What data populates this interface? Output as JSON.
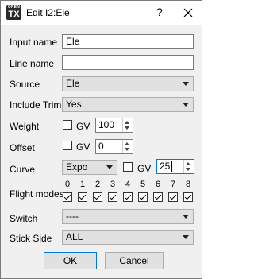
{
  "window": {
    "title": "Edit I2:Ele",
    "help": "?",
    "logo_top": "OPEN",
    "logo_main": "TX"
  },
  "form": {
    "input_name": {
      "label": "Input name",
      "value": "Ele"
    },
    "line_name": {
      "label": "Line name",
      "value": ""
    },
    "source": {
      "label": "Source",
      "value": "Ele"
    },
    "include_trim": {
      "label": "Include Trim",
      "value": "Yes"
    },
    "weight": {
      "label": "Weight",
      "gv_label": "GV",
      "gv_checked": false,
      "value": "100"
    },
    "offset": {
      "label": "Offset",
      "gv_label": "GV",
      "gv_checked": false,
      "value": "0"
    },
    "curve": {
      "label": "Curve",
      "type": "Expo",
      "gv_label": "GV",
      "gv_checked": false,
      "value": "25"
    },
    "flight_modes": {
      "label": "Flight modes",
      "modes": [
        {
          "num": "0",
          "checked": true
        },
        {
          "num": "1",
          "checked": true
        },
        {
          "num": "2",
          "checked": true
        },
        {
          "num": "3",
          "checked": true
        },
        {
          "num": "4",
          "checked": true
        },
        {
          "num": "5",
          "checked": true
        },
        {
          "num": "6",
          "checked": true
        },
        {
          "num": "7",
          "checked": true
        },
        {
          "num": "8",
          "checked": true
        }
      ]
    },
    "switch": {
      "label": "Switch",
      "value": "----"
    },
    "stick_side": {
      "label": "Stick Side",
      "value": "ALL"
    }
  },
  "buttons": {
    "ok": "OK",
    "cancel": "Cancel"
  }
}
